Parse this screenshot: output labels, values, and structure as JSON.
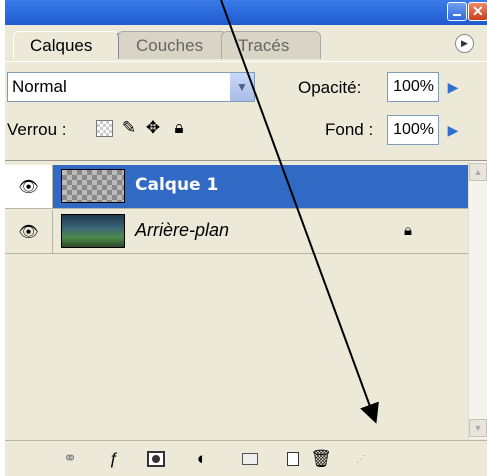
{
  "panel": {
    "tabs": [
      "Calques",
      "Couches",
      "Tracés"
    ],
    "active_tab": "Calques",
    "blend_mode": "Normal",
    "opacity_label": "Opacité:",
    "opacity_value": "100%",
    "lock_label": "Verrou :",
    "fill_label": "Fond :",
    "fill_value": "100%",
    "layers": [
      {
        "name": "Calque 1",
        "selected": true,
        "visible": true
      },
      {
        "name": "Arrière-plan",
        "selected": false,
        "visible": true,
        "locked": true
      }
    ]
  },
  "icons": {
    "eye": "eye-icon",
    "lock": "lock-icon",
    "link": "link-layers-icon",
    "style": "layer-style-icon",
    "mask": "layer-mask-icon",
    "adjust": "adjustment-layer-icon",
    "folder": "new-group-icon",
    "new_layer": "new-layer-icon",
    "trash": "delete-layer-icon"
  },
  "colors": {
    "selection": "#316ac5",
    "annotation_arrow": "#000000"
  }
}
